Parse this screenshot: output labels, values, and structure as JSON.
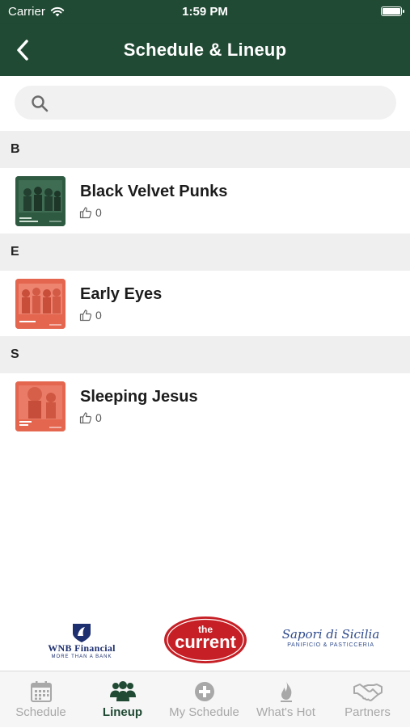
{
  "status_bar": {
    "carrier": "Carrier",
    "time": "1:59 PM"
  },
  "nav": {
    "title": "Schedule & Lineup",
    "back_icon": "chevron-left-icon"
  },
  "search": {
    "placeholder": "",
    "value": "",
    "icon": "search-icon"
  },
  "sections": [
    {
      "letter": "B",
      "artists": [
        {
          "name": "Black Velvet Punks",
          "likes": "0",
          "thumb_caption": "BLACK VELVET PUNKS"
        }
      ]
    },
    {
      "letter": "E",
      "artists": [
        {
          "name": "Early Eyes",
          "likes": "0",
          "thumb_caption": "EARLY EYES"
        }
      ]
    },
    {
      "letter": "S",
      "artists": [
        {
          "name": "Sleeping Jesus",
          "likes": "0",
          "thumb_caption": "SLEEPING JESUS"
        }
      ]
    }
  ],
  "sponsors": {
    "wnb": {
      "name": "WNB Financial",
      "tagline": "MORE THAN A BANK"
    },
    "current": {
      "the": "the",
      "word": "current"
    },
    "sapori": {
      "script": "Sapori di Sicilia",
      "sub": "PANIFICIO & PASTICCERIA"
    }
  },
  "tabs": [
    {
      "label": "Schedule",
      "icon": "calendar-icon",
      "active": false
    },
    {
      "label": "Lineup",
      "icon": "people-icon",
      "active": true
    },
    {
      "label": "My Schedule",
      "icon": "plus-circle-icon",
      "active": false
    },
    {
      "label": "What's Hot",
      "icon": "flame-icon",
      "active": false
    },
    {
      "label": "Partners",
      "icon": "handshake-icon",
      "active": false
    }
  ],
  "colors": {
    "brand_green": "#204a33",
    "section_bg": "#efefef",
    "thumb_green": "#2f5a42",
    "thumb_coral": "#e4664f",
    "current_red": "#c62026",
    "inactive_tab": "#a8a8a8"
  }
}
